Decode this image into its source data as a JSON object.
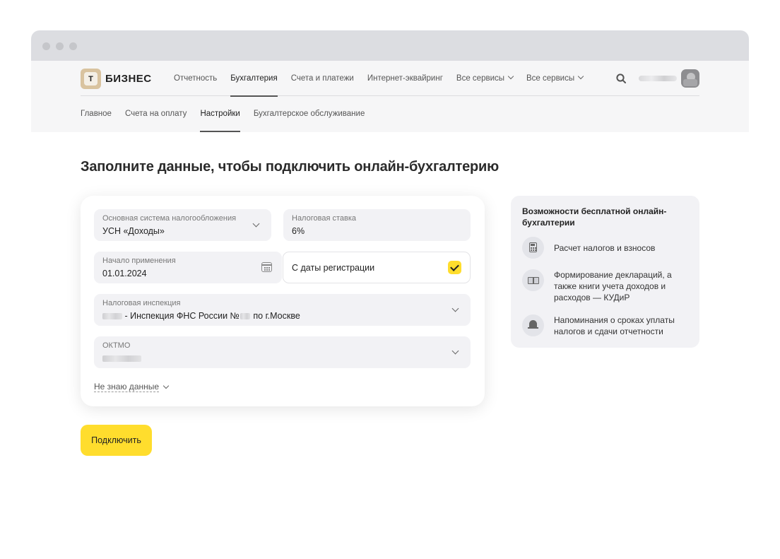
{
  "brand": {
    "badge_letter": "Т",
    "name": "БИЗНЕС"
  },
  "topnav": {
    "items": [
      {
        "label": "Отчетность"
      },
      {
        "label": "Бухгалтерия",
        "active": true
      },
      {
        "label": "Счета и платежи"
      },
      {
        "label": "Интернет-эквайринг"
      },
      {
        "label": "Все сервисы",
        "dropdown": true
      },
      {
        "label": "Все сервисы",
        "dropdown": true
      }
    ]
  },
  "subnav": {
    "items": [
      {
        "label": "Главное"
      },
      {
        "label": "Счета на оплату"
      },
      {
        "label": "Настройки",
        "active": true
      },
      {
        "label": "Бухгалтерское обслуживание"
      }
    ]
  },
  "page": {
    "title": "Заполните данные, чтобы подключить онлайн-бухгалтерию"
  },
  "form": {
    "tax_system": {
      "label": "Основная система налогообложения",
      "value": "УСН «Доходы»"
    },
    "tax_rate": {
      "label": "Налоговая ставка",
      "value": "6%"
    },
    "start_date": {
      "label": "Начало применения",
      "value": "01.01.2024"
    },
    "from_registration": {
      "label": "С даты регистрации",
      "checked": true
    },
    "inspection": {
      "label": "Налоговая инспекция",
      "value_middle": " - Инспекция ФНС России №",
      "value_end": " по г.Москве"
    },
    "oktmo": {
      "label": "ОКТМО"
    },
    "dont_know": "Не знаю данные"
  },
  "connect_button": "Подключить",
  "features": {
    "title": "Возможности бесплатной онлайн-бухгалтерии",
    "items": [
      {
        "icon": "calculator-icon",
        "text": "Расчет налогов и взносов"
      },
      {
        "icon": "book-icon",
        "text": "Формирование деклараций, а также книги учета доходов и расходов — КУДиР"
      },
      {
        "icon": "bell-icon",
        "text": "Напоминания о сроках уплаты налогов и сдачи отчетности"
      }
    ]
  },
  "colors": {
    "accent": "#ffdd2d",
    "field_bg": "#f2f2f5",
    "nav_bg": "#f6f6f7"
  }
}
